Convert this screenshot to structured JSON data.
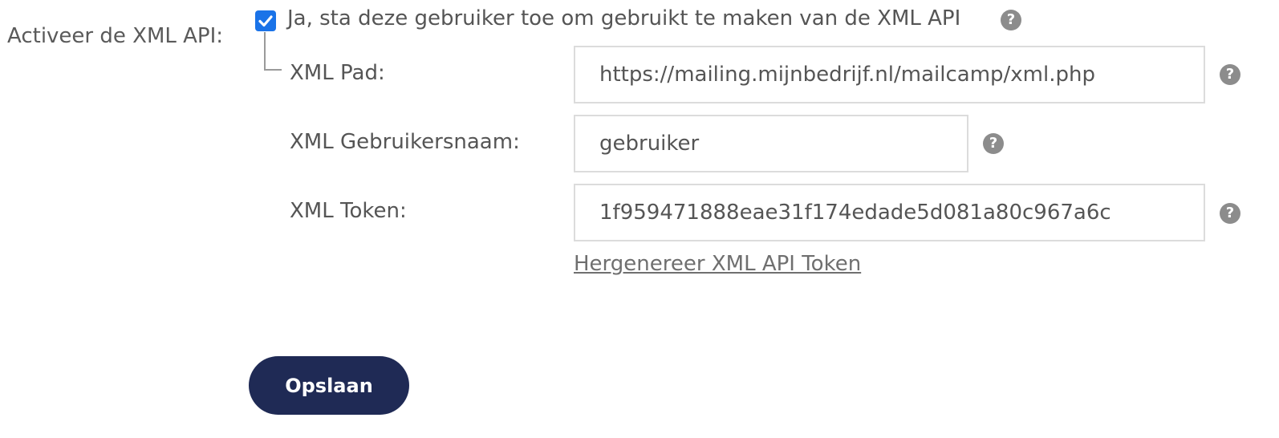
{
  "section": {
    "label": "Activeer de XML API:"
  },
  "enable": {
    "checked": true,
    "label": "Ja, sta deze gebruiker toe om gebruikt te maken van de XML API",
    "help_icon": "question-circle-icon"
  },
  "fields": {
    "path": {
      "label": "XML Pad:",
      "value": "https://mailing.mijnbedrijf.nl/mailcamp/xml.php"
    },
    "username": {
      "label": "XML Gebruikersnaam:",
      "value": "gebruiker"
    },
    "token": {
      "label": "XML Token:",
      "value": "1f959471888eae31f174edade5d081a80c967a6c"
    }
  },
  "regenerate_link": "Hergenereer XML API Token",
  "save_button": "Opslaan",
  "colors": {
    "checkbox": "#1a73e8",
    "button_bg": "#1f2a55",
    "help_icon": "#8c8c8c",
    "text": "#555555"
  }
}
